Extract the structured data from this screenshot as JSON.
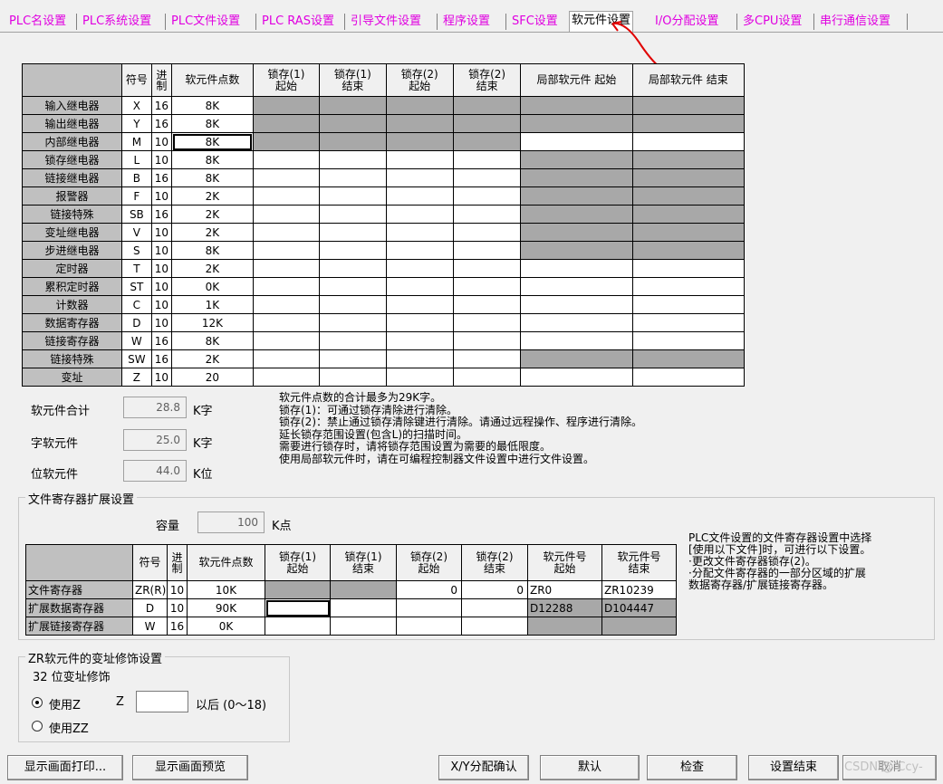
{
  "tabs": [
    "PLC名设置",
    "PLC系统设置",
    "PLC文件设置",
    "PLC RAS设置",
    "引导文件设置",
    "程序设置",
    "SFC设置",
    "软元件设置",
    "I/O分配设置",
    "多CPU设置",
    "串行通信设置"
  ],
  "active_tab": "软元件设置",
  "device_table": {
    "headers": [
      "",
      "符号",
      "进制",
      "软元件点数",
      "锁存(1)起始",
      "锁存(1)结束",
      "锁存(2)起始",
      "锁存(2)结束",
      "局部软元件 起始",
      "局部软元件 结束"
    ],
    "rows": [
      {
        "name": "输入继电器",
        "sym": "X",
        "base": "16",
        "pts": "8K"
      },
      {
        "name": "输出继电器",
        "sym": "Y",
        "base": "16",
        "pts": "8K"
      },
      {
        "name": "内部继电器",
        "sym": "M",
        "base": "10",
        "pts": "8K"
      },
      {
        "name": "锁存继电器",
        "sym": "L",
        "base": "10",
        "pts": "8K"
      },
      {
        "name": "链接继电器",
        "sym": "B",
        "base": "16",
        "pts": "8K"
      },
      {
        "name": "报警器",
        "sym": "F",
        "base": "10",
        "pts": "2K"
      },
      {
        "name": "链接特殊",
        "sym": "SB",
        "base": "16",
        "pts": "2K"
      },
      {
        "name": "变址继电器",
        "sym": "V",
        "base": "10",
        "pts": "2K"
      },
      {
        "name": "步进继电器",
        "sym": "S",
        "base": "10",
        "pts": "8K"
      },
      {
        "name": "定时器",
        "sym": "T",
        "base": "10",
        "pts": "2K"
      },
      {
        "name": "累积定时器",
        "sym": "ST",
        "base": "10",
        "pts": "0K"
      },
      {
        "name": "计数器",
        "sym": "C",
        "base": "10",
        "pts": "1K"
      },
      {
        "name": "数据寄存器",
        "sym": "D",
        "base": "10",
        "pts": "12K"
      },
      {
        "name": "链接寄存器",
        "sym": "W",
        "base": "16",
        "pts": "8K"
      },
      {
        "name": "链接特殊",
        "sym": "SW",
        "base": "16",
        "pts": "2K"
      },
      {
        "name": "变址",
        "sym": "Z",
        "base": "10",
        "pts": "20"
      }
    ]
  },
  "totals": {
    "device_total_label": "软元件合计",
    "device_total_value": "28.8",
    "device_total_unit": "K字",
    "word_label": "字软元件",
    "word_value": "25.0",
    "word_unit": "K字",
    "bit_label": "位软元件",
    "bit_value": "44.0",
    "bit_unit": "K位"
  },
  "info_text": "软元件点数的合计最多为29K字。\n锁存(1)：可通过锁存清除进行清除。\n锁存(2)：禁止通过锁存清除键进行清除。请通过远程操作、程序进行清除。\n延长锁存范围设置(包含L)的扫描时间。\n需要进行锁存时，请将锁存范围设置为需要的最低限度。\n使用局部软元件时，请在可编程控制器文件设置中进行文件设置。",
  "file_register": {
    "group_title": "文件寄存器扩展设置",
    "capacity_label": "容量",
    "capacity_value": "100",
    "capacity_unit": "K点",
    "headers": [
      "",
      "符号",
      "进制",
      "软元件点数",
      "锁存(1)起始",
      "锁存(1)结束",
      "锁存(2)起始",
      "锁存(2)结束",
      "软元件号起始",
      "软元件号结束"
    ],
    "rows": [
      {
        "name": "文件寄存器",
        "sym": "ZR(R)",
        "base": "10",
        "pts": "10K",
        "l2s": "0",
        "l2e": "0",
        "ns": "ZR0",
        "ne": "ZR10239"
      },
      {
        "name": "扩展数据寄存器",
        "sym": "D",
        "base": "10",
        "pts": "90K",
        "ns": "D12288",
        "ne": "D104447"
      },
      {
        "name": "扩展链接寄存器",
        "sym": "W",
        "base": "16",
        "pts": "0K"
      }
    ],
    "note": "PLC文件设置的文件寄存器设置中选择\n[使用以下文件]时，可进行以下设置。\n·更改文件寄存器锁存(2)。\n·分配文件寄存器的一部分区域的扩展\n数据寄存器/扩展链接寄存器。"
  },
  "zr_modify": {
    "group_title": "ZR软元件的变址修饰设置",
    "sub_label": "32 位变址修饰",
    "opt_z": "使用Z",
    "z_label": "Z",
    "z_value": "",
    "z_suffix": "以后 (0～18)",
    "opt_zz": "使用ZZ"
  },
  "buttons": {
    "print": "显示画面打印...",
    "preview": "显示画面预览",
    "xy_confirm": "X/Y分配确认",
    "default": "默认",
    "check": "检查",
    "end": "设置结束",
    "cancel": "取消"
  },
  "watermark": "CSDN @ Ccy-"
}
